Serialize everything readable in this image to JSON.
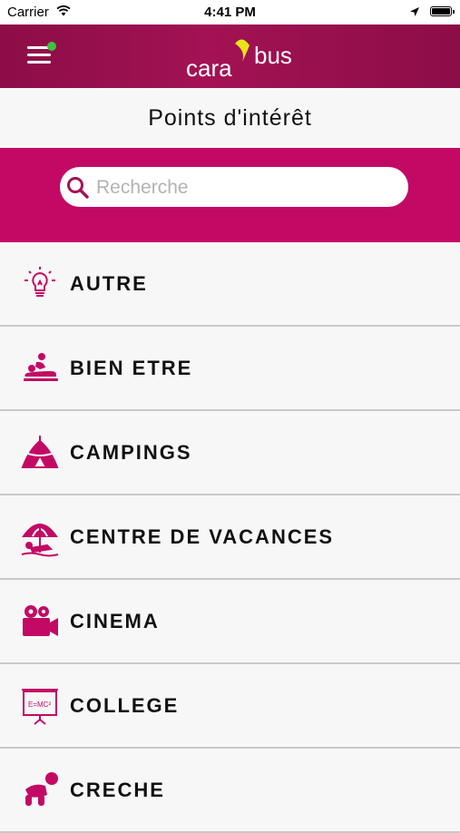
{
  "status_bar": {
    "carrier": "Carrier",
    "time": "4:41 PM"
  },
  "header": {
    "logo_text_left": "cara",
    "logo_text_right": "bus",
    "brand_color": "#8c0d47",
    "dot_color": "#3cc23c"
  },
  "page": {
    "title": "Points d'intérêt"
  },
  "search": {
    "placeholder": "Recherche",
    "band_color": "#c20a65"
  },
  "categories": [
    {
      "label": "AUTRE",
      "icon": "lightbulb-icon"
    },
    {
      "label": "BIEN ETRE",
      "icon": "massage-icon"
    },
    {
      "label": "CAMPINGS",
      "icon": "tent-icon"
    },
    {
      "label": "CENTRE DE VACANCES",
      "icon": "beach-umbrella-icon"
    },
    {
      "label": "CINEMA",
      "icon": "movie-camera-icon"
    },
    {
      "label": "COLLEGE",
      "icon": "blackboard-icon"
    },
    {
      "label": "CRECHE",
      "icon": "baby-crawling-icon"
    }
  ],
  "accent_color": "#c20a65"
}
